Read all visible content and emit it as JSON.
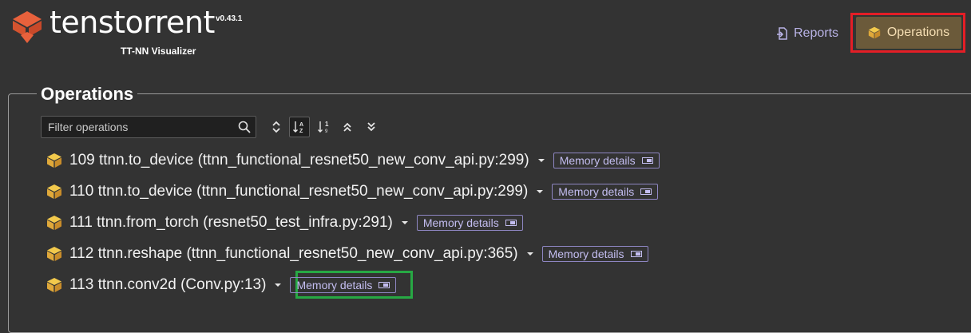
{
  "header": {
    "brand": "tenstorrent",
    "version": "v0.43.1",
    "subtitle": "TT-NN Visualizer",
    "nav": {
      "reports_label": "Reports",
      "operations_label": "Operations"
    }
  },
  "colors": {
    "background": "#333333",
    "accent_logo": "#e8613c",
    "active_nav_bg": "#6b5a3a",
    "nav_highlight_outline": "#e41e26",
    "memory_highlight_outline": "#27a844",
    "link_lavender": "#b9b3e6"
  },
  "operations_panel": {
    "title": "Operations",
    "filter_placeholder": "Filter operations",
    "toolbar_icons": [
      "sort-toggle-icon",
      "sort-alpha-icon",
      "sort-numeric-icon",
      "collapse-all-icon",
      "expand-all-icon"
    ],
    "items": [
      {
        "label": "109 ttnn.to_device (ttnn_functional_resnet50_new_conv_api.py:299)",
        "memory_label": "Memory details"
      },
      {
        "label": "110 ttnn.to_device (ttnn_functional_resnet50_new_conv_api.py:299)",
        "memory_label": "Memory details"
      },
      {
        "label": "111 ttnn.from_torch (resnet50_test_infra.py:291)",
        "memory_label": "Memory details"
      },
      {
        "label": "112 ttnn.reshape (ttnn_functional_resnet50_new_conv_api.py:365)",
        "memory_label": "Memory details"
      },
      {
        "label": "113 ttnn.conv2d (Conv.py:13)",
        "memory_label": "Memory details"
      }
    ]
  }
}
